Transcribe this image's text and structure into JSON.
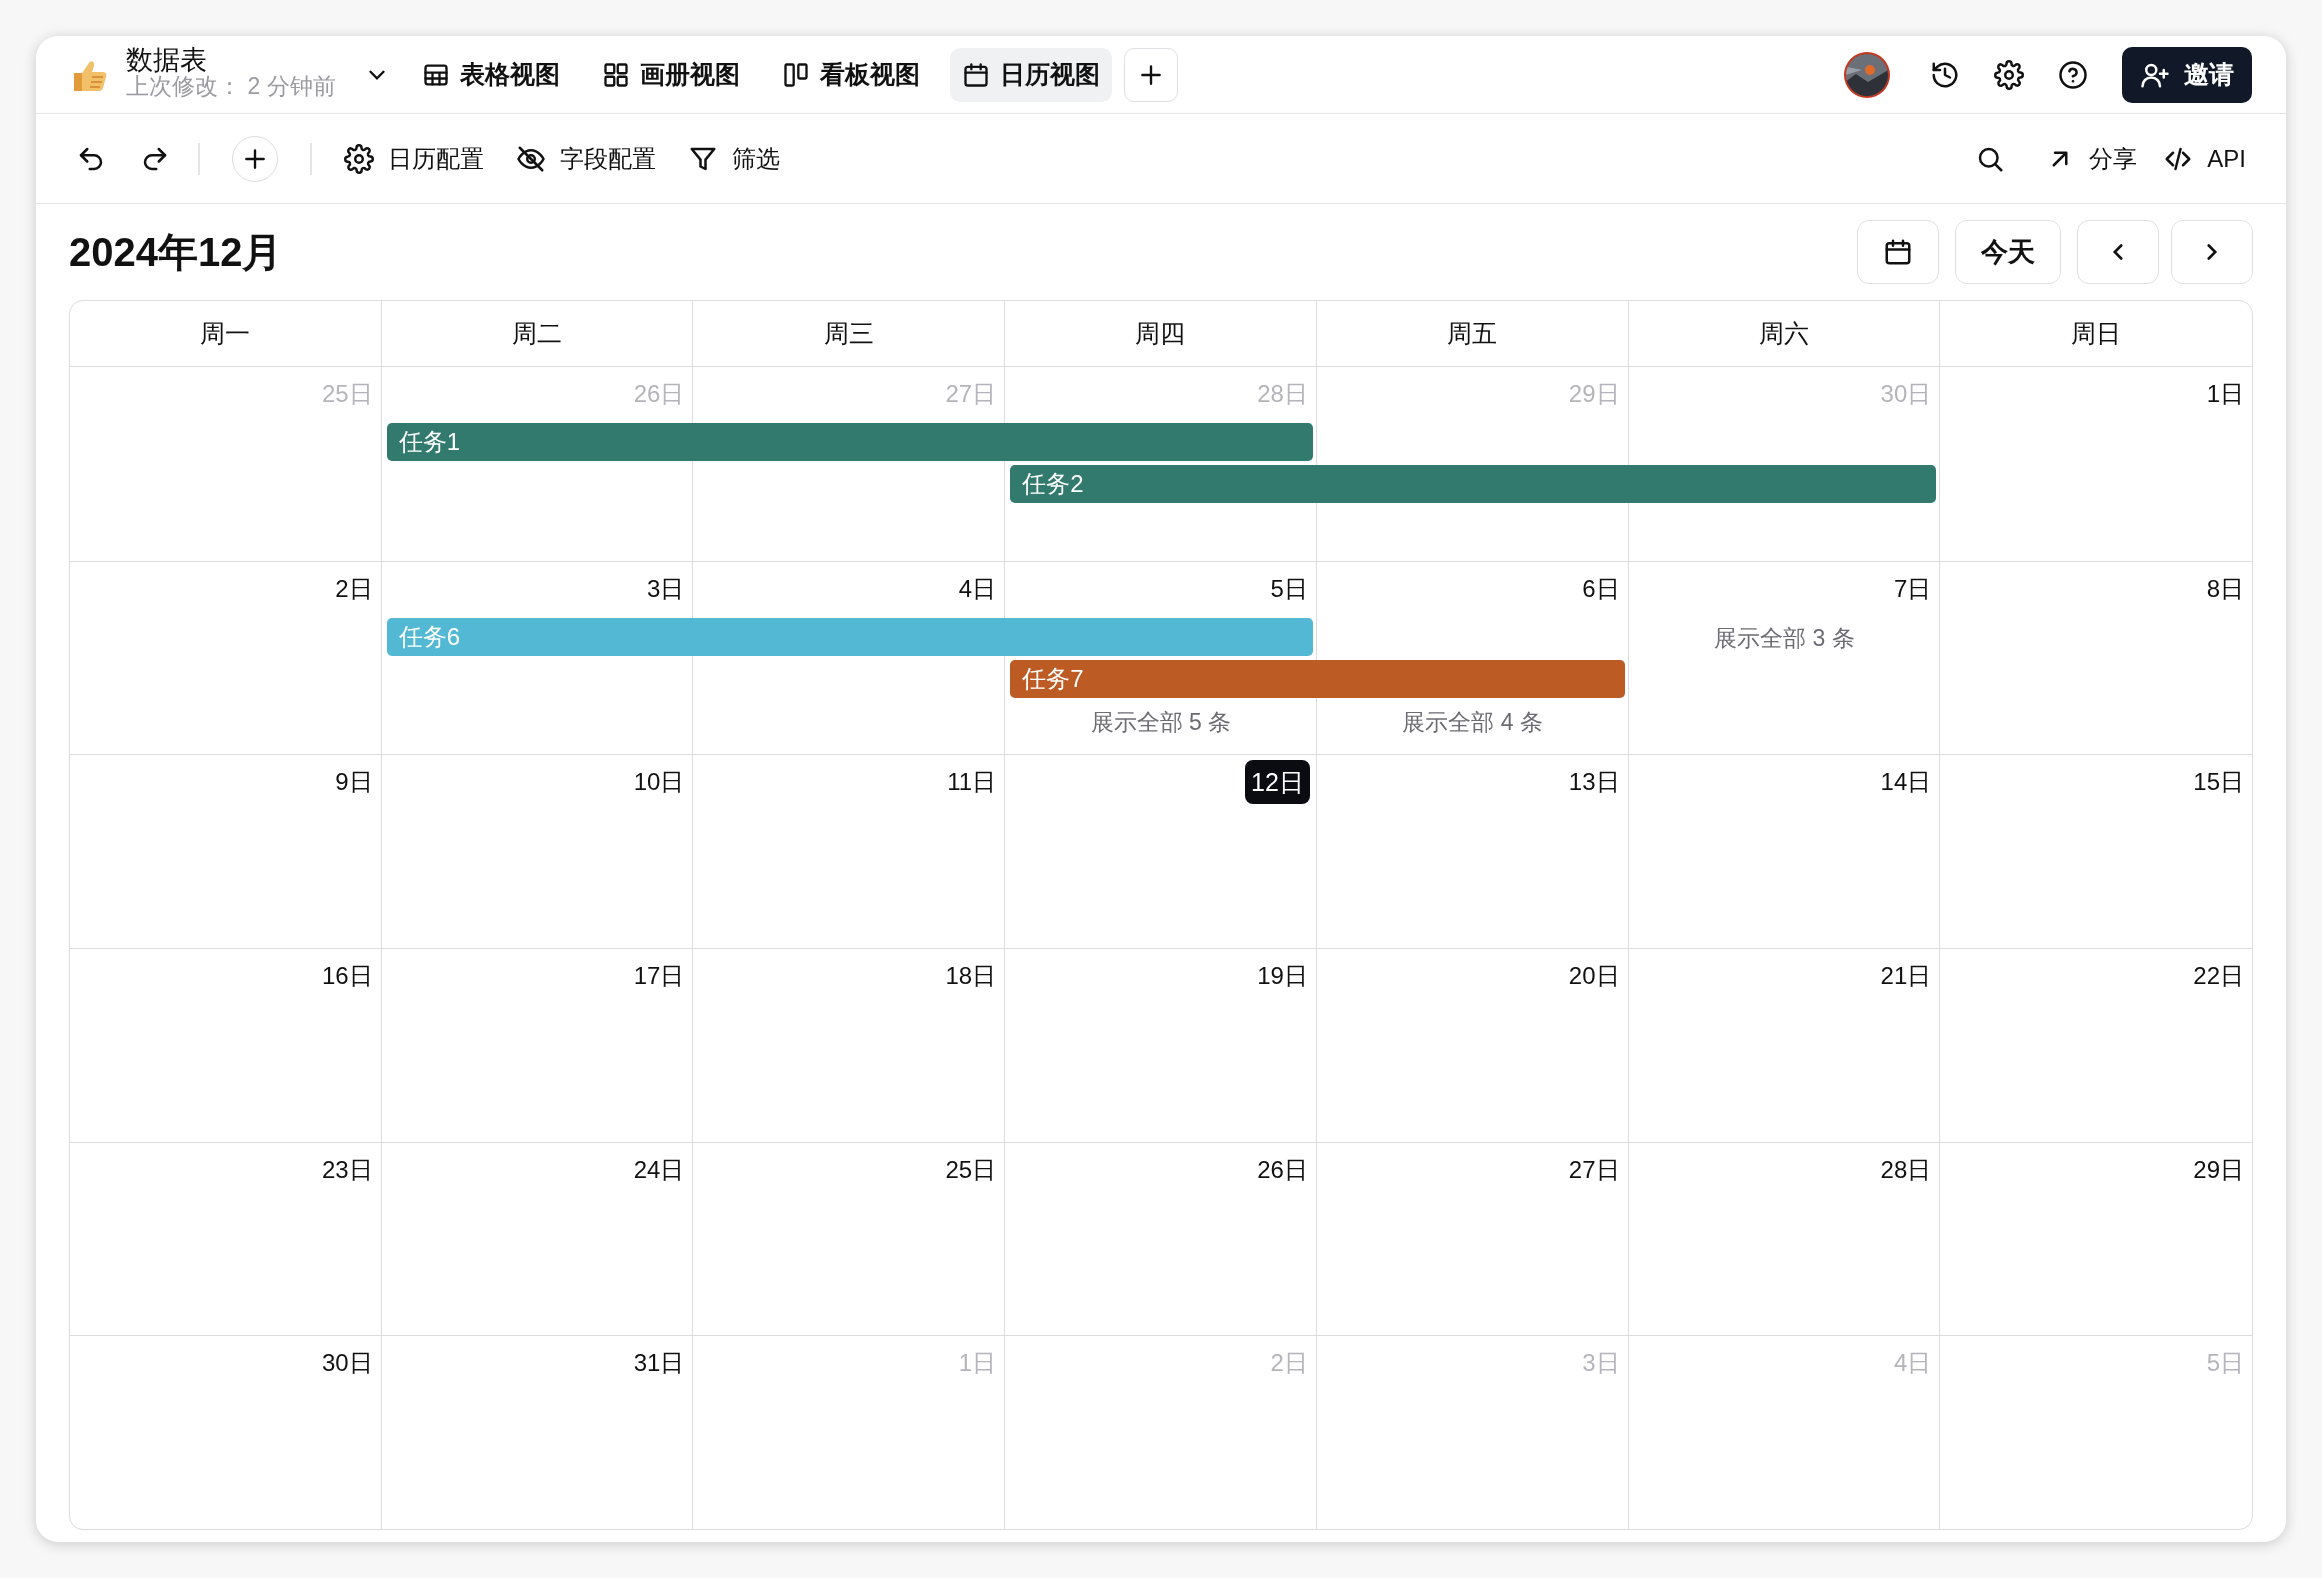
{
  "app": {
    "title": "数据表",
    "subtitle": "上次修改： 2 分钟前"
  },
  "views": [
    {
      "label": "表格视图",
      "kind": "table",
      "selected": false
    },
    {
      "label": "画册视图",
      "kind": "gallery",
      "selected": false
    },
    {
      "label": "看板视图",
      "kind": "kanban",
      "selected": false
    },
    {
      "label": "日历视图",
      "kind": "calendar",
      "selected": true
    }
  ],
  "invite": "邀请",
  "actions": [
    {
      "label": "日历配置",
      "kind": "gear"
    },
    {
      "label": "字段配置",
      "kind": "eye-off"
    },
    {
      "label": "筛选",
      "kind": "filter"
    }
  ],
  "right_actions": [
    {
      "label": "分享",
      "kind": "share"
    },
    {
      "label": "API",
      "kind": "code"
    }
  ],
  "month_title": "2024年12月",
  "today_button": "今天",
  "weekdays": [
    "周一",
    "周二",
    "周三",
    "周四",
    "周五",
    "周六",
    "周日"
  ],
  "weeks": [
    {
      "days": [
        {
          "label": "25日",
          "muted": true,
          "today": false
        },
        {
          "label": "26日",
          "muted": true,
          "today": false,
          "segments": [
            {
              "kind": "start",
              "label": "任务1",
              "color": "#317a6d"
            }
          ]
        },
        {
          "label": "27日",
          "muted": true,
          "today": false,
          "segments": [
            {
              "kind": "middle"
            }
          ]
        },
        {
          "label": "28日",
          "muted": true,
          "today": false,
          "segments": [
            {
              "kind": "end"
            },
            {
              "kind": "start",
              "label": "任务2",
              "color": "#317a6d"
            }
          ]
        },
        {
          "label": "29日",
          "muted": true,
          "today": false,
          "segments": [
            {
              "kind": "empty"
            },
            {
              "kind": "middle"
            }
          ]
        },
        {
          "label": "30日",
          "muted": true,
          "today": false,
          "segments": [
            {
              "kind": "empty"
            },
            {
              "kind": "end"
            }
          ]
        },
        {
          "label": "1日",
          "muted": false,
          "today": false
        }
      ]
    },
    {
      "days": [
        {
          "label": "2日",
          "muted": false,
          "today": false
        },
        {
          "label": "3日",
          "muted": false,
          "today": false,
          "segments": [
            {
              "kind": "start",
              "label": "任务6",
              "color": "#53b8d3"
            }
          ]
        },
        {
          "label": "4日",
          "muted": false,
          "today": false,
          "segments": [
            {
              "kind": "middle"
            }
          ]
        },
        {
          "label": "5日",
          "muted": false,
          "today": false,
          "more": "展示全部 5 条",
          "segments": [
            {
              "kind": "end"
            },
            {
              "kind": "start",
              "label": "任务7",
              "color": "#bd5b24"
            }
          ]
        },
        {
          "label": "6日",
          "muted": false,
          "today": false,
          "more": "展示全部 4 条",
          "segments": [
            {
              "kind": "empty"
            },
            {
              "kind": "end"
            }
          ]
        },
        {
          "label": "7日",
          "muted": false,
          "today": false,
          "more": "展示全部 3 条"
        },
        {
          "label": "8日",
          "muted": false,
          "today": false
        }
      ]
    },
    {
      "days": [
        {
          "label": "9日",
          "muted": false,
          "today": false
        },
        {
          "label": "10日",
          "muted": false,
          "today": false
        },
        {
          "label": "11日",
          "muted": false,
          "today": false
        },
        {
          "label": "12日",
          "muted": false,
          "today": true
        },
        {
          "label": "13日",
          "muted": false,
          "today": false
        },
        {
          "label": "14日",
          "muted": false,
          "today": false
        },
        {
          "label": "15日",
          "muted": false,
          "today": false
        }
      ]
    },
    {
      "days": [
        {
          "label": "16日",
          "muted": false,
          "today": false
        },
        {
          "label": "17日",
          "muted": false,
          "today": false
        },
        {
          "label": "18日",
          "muted": false,
          "today": false
        },
        {
          "label": "19日",
          "muted": false,
          "today": false
        },
        {
          "label": "20日",
          "muted": false,
          "today": false
        },
        {
          "label": "21日",
          "muted": false,
          "today": false
        },
        {
          "label": "22日",
          "muted": false,
          "today": false
        }
      ]
    },
    {
      "days": [
        {
          "label": "23日",
          "muted": false,
          "today": false
        },
        {
          "label": "24日",
          "muted": false,
          "today": false
        },
        {
          "label": "25日",
          "muted": false,
          "today": false
        },
        {
          "label": "26日",
          "muted": false,
          "today": false
        },
        {
          "label": "27日",
          "muted": false,
          "today": false
        },
        {
          "label": "28日",
          "muted": false,
          "today": false
        },
        {
          "label": "29日",
          "muted": false,
          "today": false
        }
      ]
    },
    {
      "days": [
        {
          "label": "30日",
          "muted": false,
          "today": false
        },
        {
          "label": "31日",
          "muted": false,
          "today": false
        },
        {
          "label": "1日",
          "muted": true,
          "today": false
        },
        {
          "label": "2日",
          "muted": true,
          "today": false
        },
        {
          "label": "3日",
          "muted": true,
          "today": false
        },
        {
          "label": "4日",
          "muted": true,
          "today": false
        },
        {
          "label": "5日",
          "muted": true,
          "today": false
        }
      ]
    }
  ]
}
